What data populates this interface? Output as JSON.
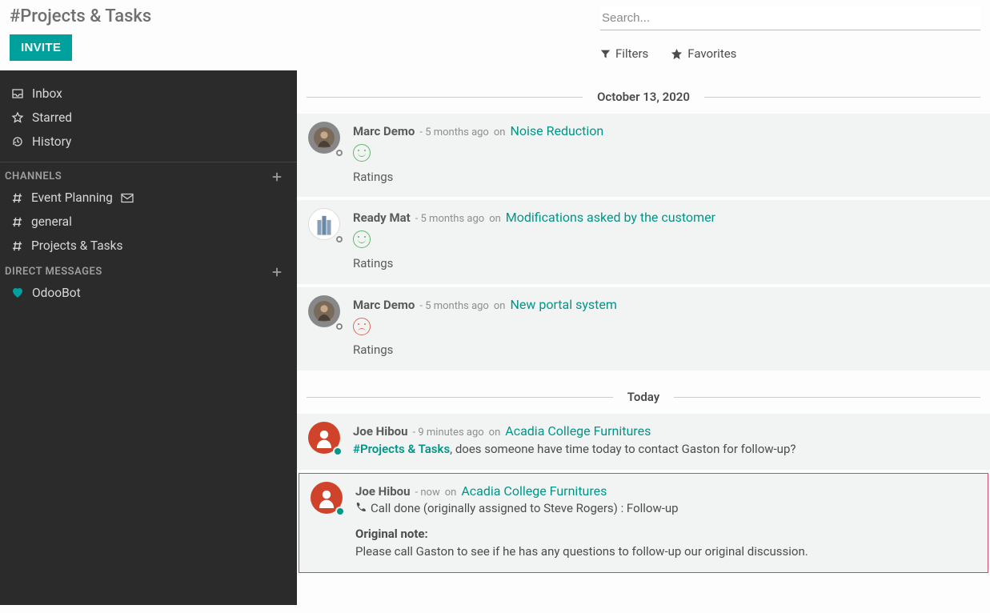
{
  "header": {
    "title": "#Projects & Tasks",
    "invite_label": "INVITE"
  },
  "search": {
    "placeholder": "Search...",
    "filters_label": "Filters",
    "favorites_label": "Favorites"
  },
  "sidebar": {
    "inbox": "Inbox",
    "starred": "Starred",
    "history": "History",
    "channels_header": "CHANNELS",
    "channels": [
      {
        "name": "Event Planning",
        "has_mail": true
      },
      {
        "name": "general",
        "has_mail": false
      },
      {
        "name": "Projects & Tasks",
        "has_mail": false
      }
    ],
    "dm_header": "DIRECT MESSAGES",
    "dm": [
      {
        "name": "OdooBot"
      }
    ]
  },
  "dates": {
    "d1": "October 13, 2020",
    "d2": "Today"
  },
  "messages": {
    "m1": {
      "author": "Marc Demo",
      "time": "- 5 months ago",
      "on": "on",
      "link": "Noise Reduction",
      "rating_face": "happy",
      "ratings_label": "Ratings"
    },
    "m2": {
      "author": "Ready Mat",
      "time": "- 5 months ago",
      "on": "on",
      "link": "Modifications asked by the customer",
      "rating_face": "happy",
      "ratings_label": "Ratings"
    },
    "m3": {
      "author": "Marc Demo",
      "time": "- 5 months ago",
      "on": "on",
      "link": "New portal system",
      "rating_face": "sad",
      "ratings_label": "Ratings"
    },
    "m4": {
      "author": "Joe Hibou",
      "time": "- 9 minutes ago",
      "on": "on",
      "link": "Acadia College Furnitures",
      "mention": "#Projects & Tasks",
      "body": ", does someone have time today to contact Gaston for follow-up?"
    },
    "m5": {
      "author": "Joe Hibou",
      "time": "- now",
      "on": "on",
      "link": "Acadia College Furnitures",
      "call_line": "Call done (originally assigned to Steve Rogers) : Follow-up",
      "note_header": "Original note:",
      "note_body": "Please call Gaston to see if he has any questions to follow-up our original discussion."
    }
  }
}
